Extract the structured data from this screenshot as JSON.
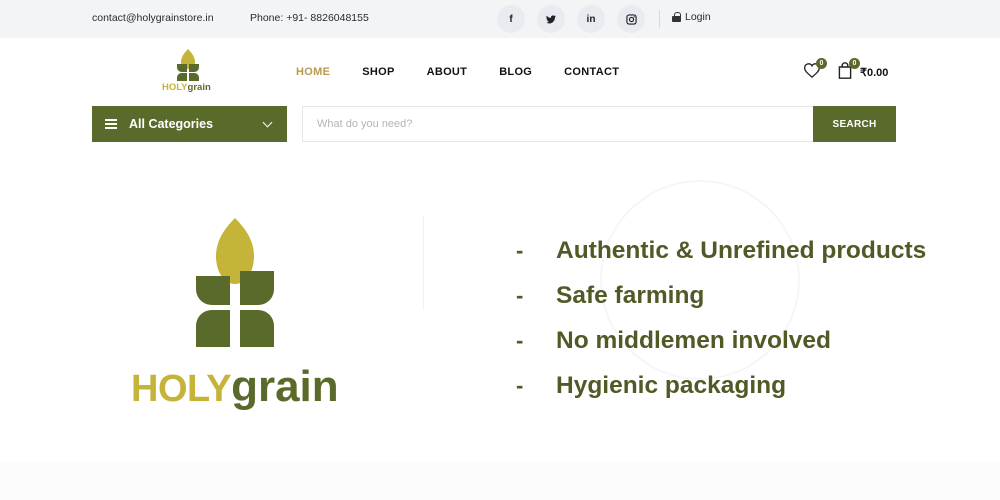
{
  "topbar": {
    "email": "contact@holygrainstore.in",
    "phone": "Phone: +91- 8826048155",
    "socials": [
      {
        "icon": "facebook-icon",
        "glyph": "f"
      },
      {
        "icon": "twitter-icon",
        "glyph": "t"
      },
      {
        "icon": "linkedin-icon",
        "glyph": "in"
      },
      {
        "icon": "instagram-icon",
        "glyph": "◎"
      }
    ],
    "login_label": "Login"
  },
  "header": {
    "logo_holy": "HOLY",
    "logo_grain": "grain",
    "nav": [
      {
        "label": "HOME",
        "active": true
      },
      {
        "label": "SHOP",
        "active": false
      },
      {
        "label": "ABOUT",
        "active": false
      },
      {
        "label": "BLOG",
        "active": false
      },
      {
        "label": "CONTACT",
        "active": false
      }
    ],
    "wishlist_count": "0",
    "cart_count": "0",
    "cart_total": "₹0.00"
  },
  "search": {
    "category_label": "All Categories",
    "placeholder": "What do you need?",
    "button_label": "SEARCH"
  },
  "banner": {
    "brand_holy": "HOLY",
    "brand_grain": "grain",
    "features": [
      "Authentic & Unrefined products",
      "Safe farming",
      "No middlemen involved",
      "Hygienic packaging"
    ],
    "bullet": "-"
  },
  "colors": {
    "brand_green": "#5a6a2a",
    "brand_yellow": "#c4b43a",
    "nav_active": "#b89a4e",
    "topbar_bg": "#f3f4f6"
  }
}
